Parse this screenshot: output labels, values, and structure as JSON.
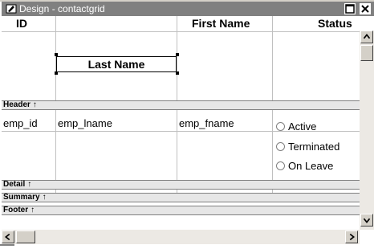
{
  "window": {
    "title": "Design - contactgrid",
    "restore_symbol": "□",
    "close_symbol": "×"
  },
  "columns": {
    "id": "ID",
    "first_name": "First Name",
    "status": "Status",
    "last_name": "Last Name"
  },
  "bands": {
    "header": "Header",
    "detail": "Detail",
    "summary": "Summary",
    "footer": "Footer",
    "arrow": "↑"
  },
  "detail_fields": {
    "emp_id": "emp_id",
    "emp_lname": "emp_lname",
    "emp_fname": "emp_fname"
  },
  "status_options": [
    "Active",
    "Terminated",
    "On Leave"
  ],
  "icons": [
    "window-icon",
    "restore-icon",
    "close-icon",
    "scroll-up-icon",
    "scroll-down-icon",
    "scroll-left-icon",
    "scroll-right-icon"
  ]
}
